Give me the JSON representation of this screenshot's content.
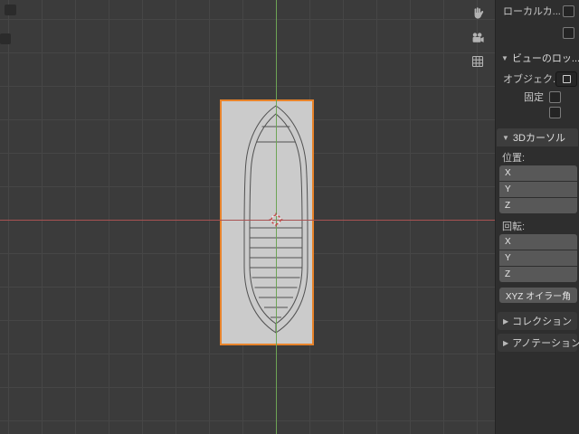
{
  "colors": {
    "viewport_bg": "#3b3b3b",
    "grid_line": "#464646",
    "axis_x_red": "#a85252",
    "axis_y_green": "#6da455",
    "selection_outline": "#e8832a",
    "object_fill": "#cbcbcb",
    "wireframe": "#515151",
    "panel_bg": "#2e2e2e",
    "field_bg": "#585858"
  },
  "viewport": {
    "icons": [
      "pan-hand",
      "camera-view",
      "grid-orthographic"
    ],
    "cursor": "3d-cursor"
  },
  "sidebar": {
    "expanded_marker": "▼",
    "collapsed_marker": "▶",
    "local_camera": {
      "label": "ローカルカ..."
    },
    "view_lock": {
      "header": "ビューのロッ...",
      "object_label": "オブジェク...",
      "lock_label": "固定"
    },
    "cursor_3d": {
      "header": "3Dカーソル",
      "location_label": "位置:",
      "rotation_label": "回転:",
      "location_axes": [
        "X",
        "Y",
        "Z"
      ],
      "rotation_axes": [
        "X",
        "Y",
        "Z"
      ],
      "rotation_order": "XYZ オイラー角"
    },
    "collection": {
      "header": "コレクション"
    },
    "annotation": {
      "header": "アノテーション"
    }
  }
}
